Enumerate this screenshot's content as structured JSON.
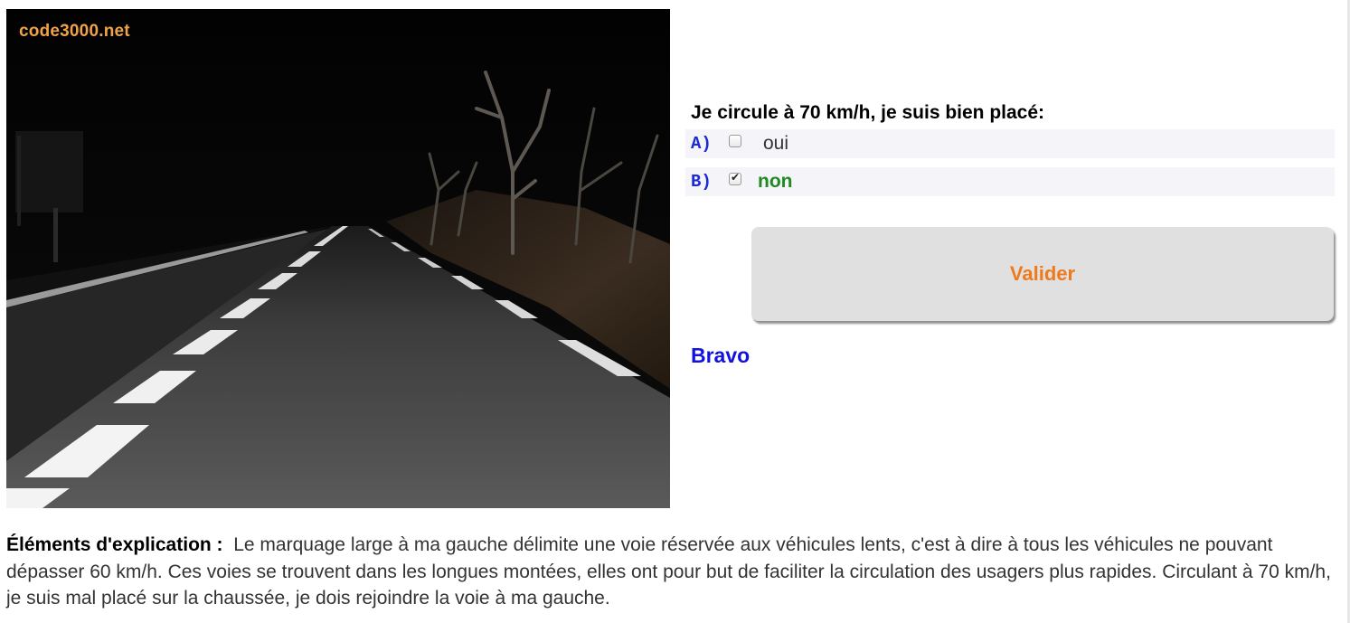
{
  "image": {
    "watermark": "code3000.net"
  },
  "quiz": {
    "question": "Je circule à 70 km/h, je suis bien placé:",
    "answers": [
      {
        "letter": "A)",
        "text": "oui",
        "checked": false
      },
      {
        "letter": "B)",
        "text": "non",
        "checked": true
      }
    ],
    "validate_label": "Valider",
    "feedback": "Bravo"
  },
  "explanation": {
    "label": "Éléments d'explication :",
    "text": "Le marquage large à ma gauche délimite une voie réservée aux véhicules lents, c'est à dire à tous les véhicules ne pouvant dépasser 60 km/h. Ces voies se trouvent dans les longues montées, elles ont pour but de faciliter la circulation des usagers plus rapides. Circulant à 70 km/h, je suis mal placé sur la chaussée, je dois rejoindre la voie à ma gauche."
  },
  "colors": {
    "letter": "#1b2bd6",
    "correct_answer": "#1f8a1f",
    "button_text": "#ee7a1c",
    "button_bg": "#e0e0e0",
    "feedback": "#1212e0",
    "watermark": "#f0a24a"
  }
}
